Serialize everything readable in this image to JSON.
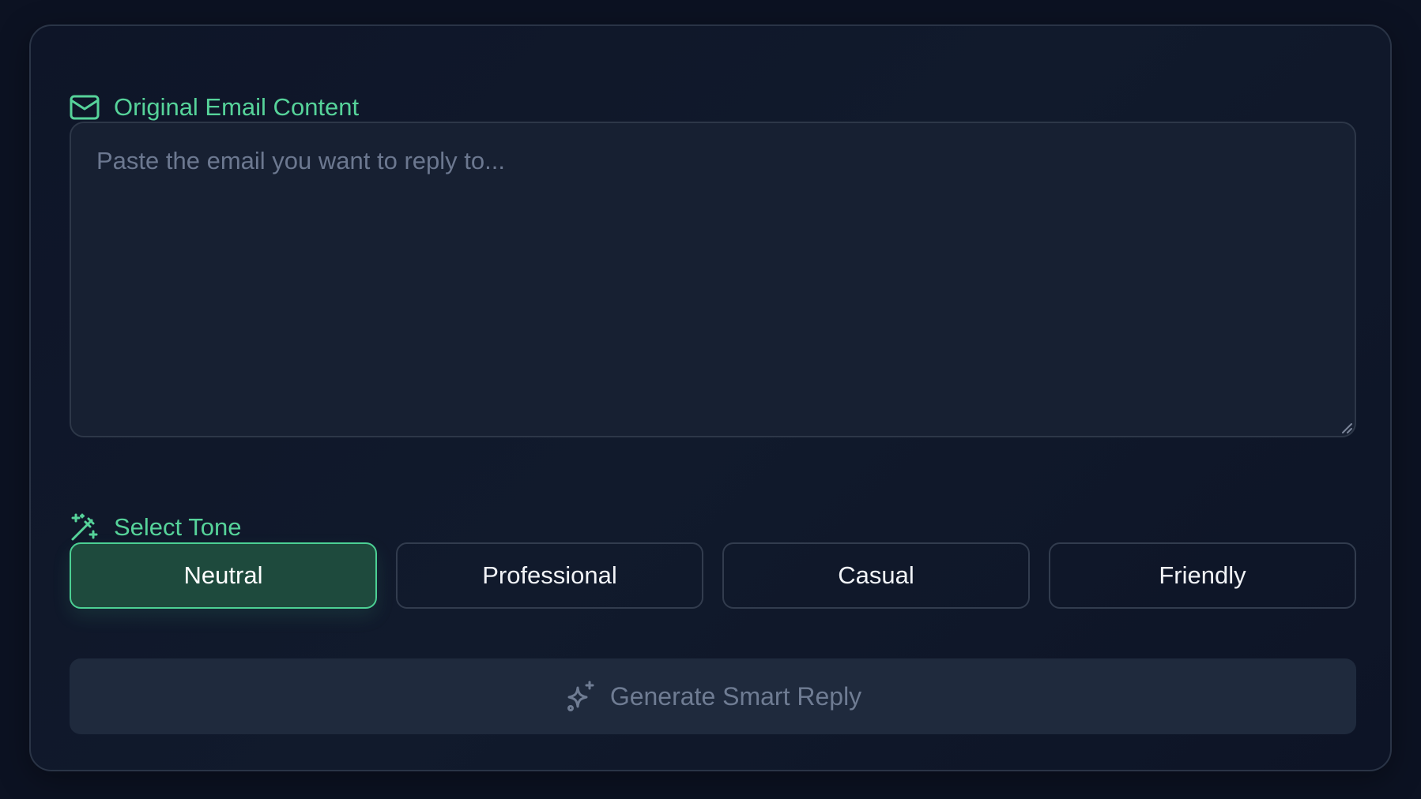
{
  "email_section": {
    "title": "Original Email Content",
    "icon": "mail-icon",
    "input_value": "",
    "placeholder": "Paste the email you want to reply to..."
  },
  "tone_section": {
    "title": "Select Tone",
    "icon": "magic-wand-icon",
    "options": [
      {
        "label": "Neutral",
        "selected": true
      },
      {
        "label": "Professional",
        "selected": false
      },
      {
        "label": "Casual",
        "selected": false
      },
      {
        "label": "Friendly",
        "selected": false
      }
    ]
  },
  "generate_button": {
    "label": "Generate Smart Reply",
    "icon": "sparkles-icon",
    "disabled": true
  },
  "colors": {
    "accent": "#56d39a",
    "selected_bg": "#1e4a3d",
    "page_bg": "#0c1222",
    "input_bg": "#172032",
    "disabled_text": "#6f7c93"
  }
}
